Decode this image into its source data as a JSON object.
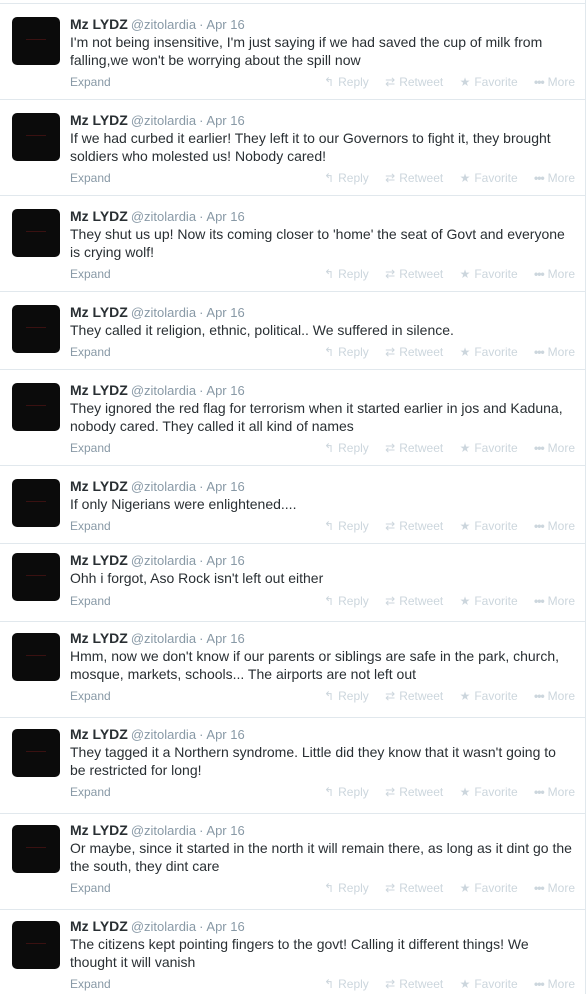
{
  "actions": {
    "expand": "Expand",
    "reply": "Reply",
    "retweet": "Retweet",
    "favorite": "Favorite",
    "more": "More"
  },
  "icons": {
    "reply": "reply-icon",
    "retweet": "retweet-icon",
    "favorite": "star-icon",
    "more": "more-dots-icon"
  },
  "colors": {
    "name": "#292f33",
    "meta": "#8899a6",
    "action": "#ccd6dd",
    "divider": "#e1e8ed",
    "avatar": "#0b0b0b"
  },
  "tweets": [
    {
      "fullname": "Mz LYDZ",
      "username": "@zitolardia",
      "date": "Apr 16",
      "text": "I'm not being insensitive, I'm just saying if we had saved the cup of milk from falling,we won't be worrying about the spill now"
    },
    {
      "fullname": "Mz LYDZ",
      "username": "@zitolardia",
      "date": "Apr 16",
      "text": "If we had curbed it earlier! They left it to our Governors to fight it, they brought soldiers who molested us! Nobody cared!"
    },
    {
      "fullname": "Mz LYDZ",
      "username": "@zitolardia",
      "date": "Apr 16",
      "text": "They shut us up! Now its coming closer to 'home' the seat of Govt and everyone is crying wolf!"
    },
    {
      "fullname": "Mz LYDZ",
      "username": "@zitolardia",
      "date": "Apr 16",
      "text": "They called it religion, ethnic, political.. We suffered in silence."
    },
    {
      "fullname": "Mz LYDZ",
      "username": "@zitolardia",
      "date": "Apr 16",
      "text": "They ignored the red flag for terrorism when it started earlier in jos and Kaduna, nobody cared. They called it all kind of names"
    },
    {
      "fullname": "Mz LYDZ",
      "username": "@zitolardia",
      "date": "Apr 16",
      "text": "If only Nigerians were enlightened...."
    },
    {
      "fullname": "Mz LYDZ",
      "username": "@zitolardia",
      "date": "Apr 16",
      "text": "Ohh i forgot, Aso Rock isn't left out either"
    },
    {
      "fullname": "Mz LYDZ",
      "username": "@zitolardia",
      "date": "Apr 16",
      "text": "Hmm, now we don't know if our parents or siblings are safe in the park, church, mosque, markets, schools... The airports are not left out"
    },
    {
      "fullname": "Mz LYDZ",
      "username": "@zitolardia",
      "date": "Apr 16",
      "text": "They tagged it a Northern syndrome. Little did they know that it wasn't going to be restricted for long!"
    },
    {
      "fullname": "Mz LYDZ",
      "username": "@zitolardia",
      "date": "Apr 16",
      "text": "Or maybe, since it started in the north it will remain there, as long as it dint go the the south, they dint care"
    },
    {
      "fullname": "Mz LYDZ",
      "username": "@zitolardia",
      "date": "Apr 16",
      "text": "The citizens kept pointing fingers to the govt! Calling it different things! We thought it will vanish"
    }
  ]
}
